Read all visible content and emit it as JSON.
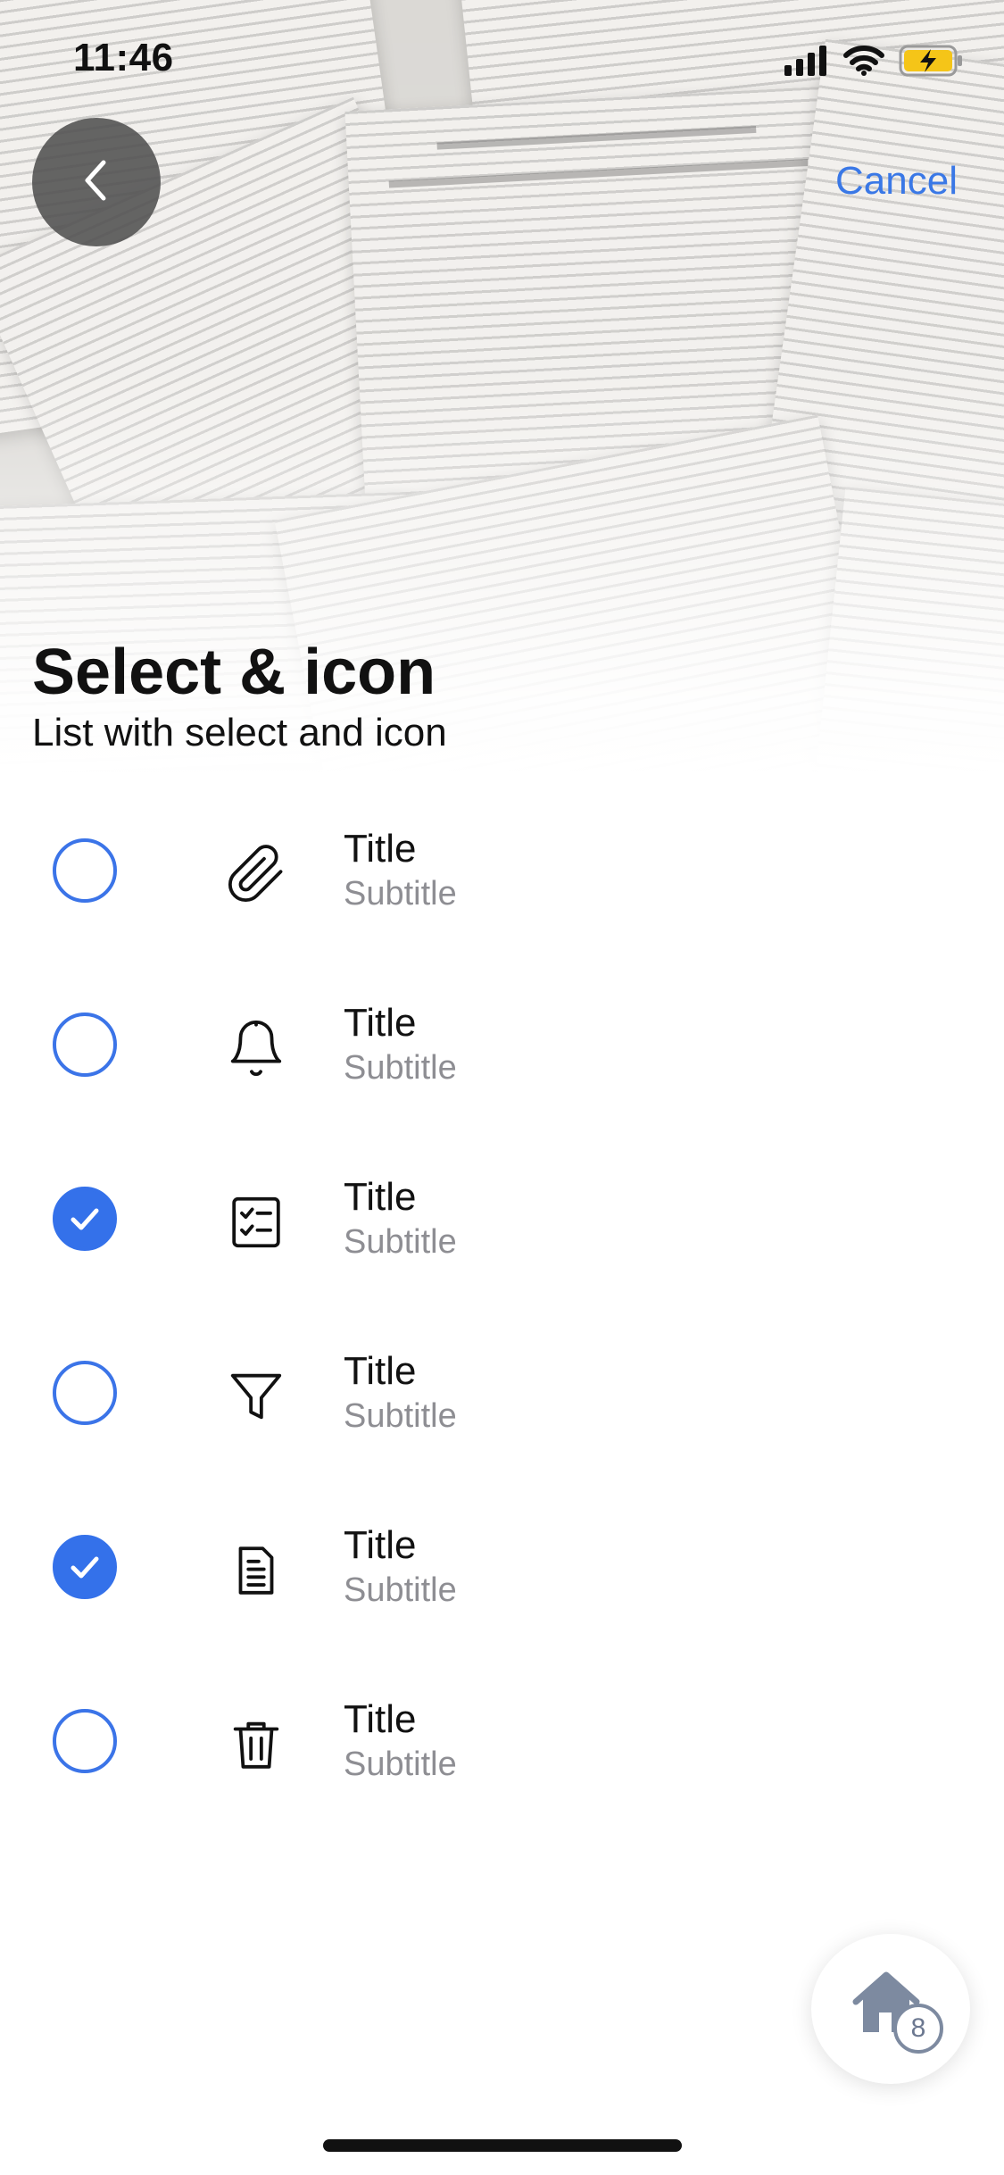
{
  "status_bar": {
    "time": "11:46",
    "icons": [
      "cellular-signal-icon",
      "wifi-icon",
      "battery-charging-icon"
    ]
  },
  "nav": {
    "back_icon": "chevron-left-icon",
    "cancel_label": "Cancel"
  },
  "header": {
    "title": "Select & icon",
    "subtitle": "List with select and icon"
  },
  "list": {
    "items": [
      {
        "title": "Title",
        "subtitle": "Subtitle",
        "icon": "paperclip-icon",
        "selected": false
      },
      {
        "title": "Title",
        "subtitle": "Subtitle",
        "icon": "bell-icon",
        "selected": false
      },
      {
        "title": "Title",
        "subtitle": "Subtitle",
        "icon": "checklist-icon",
        "selected": true
      },
      {
        "title": "Title",
        "subtitle": "Subtitle",
        "icon": "filter-icon",
        "selected": false
      },
      {
        "title": "Title",
        "subtitle": "Subtitle",
        "icon": "document-icon",
        "selected": true
      },
      {
        "title": "Title",
        "subtitle": "Subtitle",
        "icon": "trash-icon",
        "selected": false
      }
    ]
  },
  "home_button": {
    "icon": "home-icon",
    "badge": "8"
  },
  "colors": {
    "accent": "#3471EA",
    "text_primary": "#111111",
    "text_secondary": "#8E8E93",
    "back_button_bg": "#505050",
    "battery_fill": "#F5C518"
  }
}
